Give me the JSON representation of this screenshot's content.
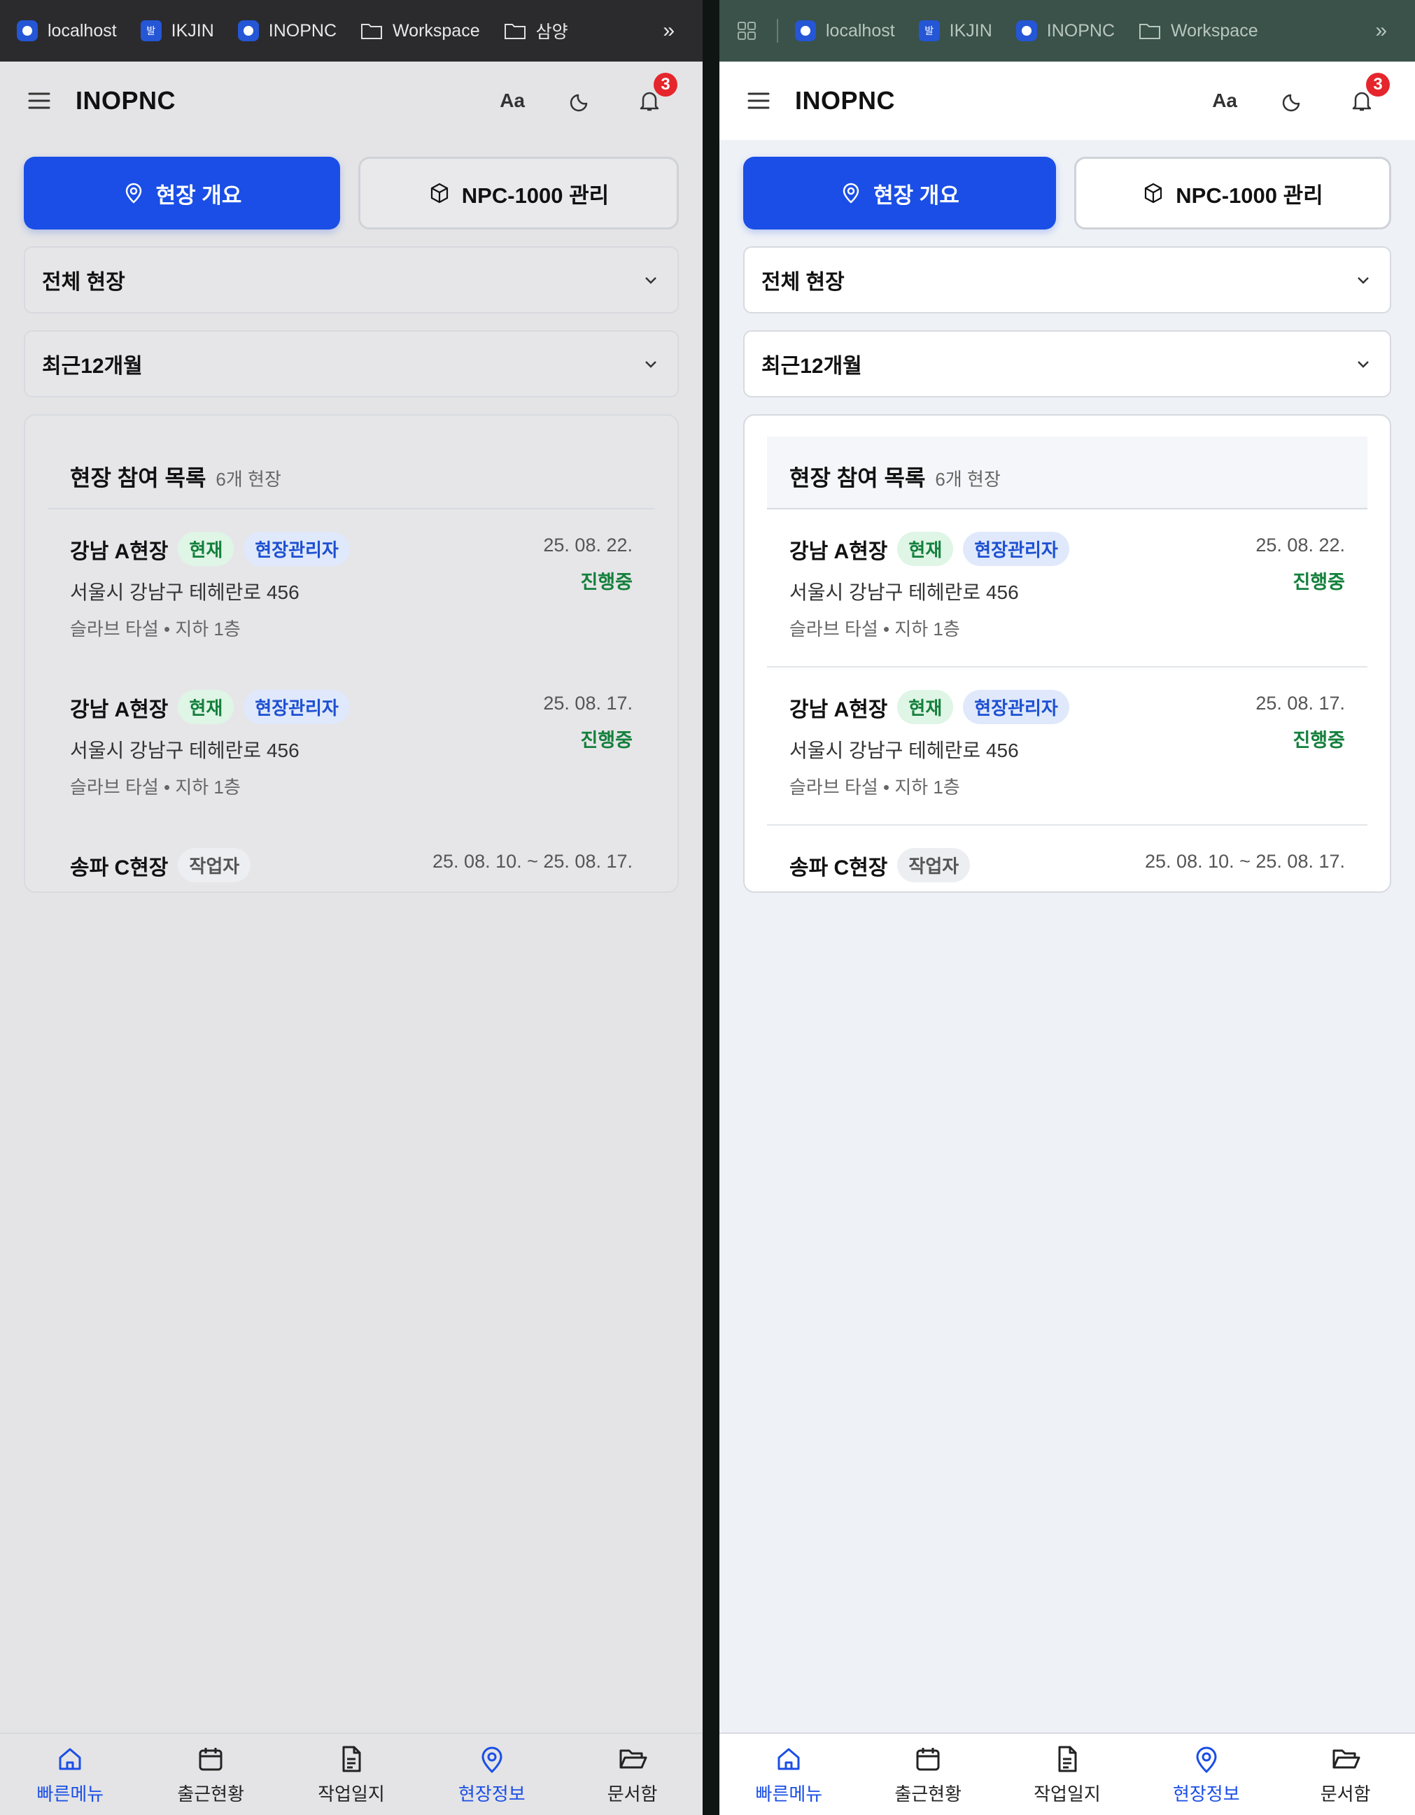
{
  "bookmarks_left": [
    {
      "label": "localhost",
      "icon": "app-favicon"
    },
    {
      "label": "IKJIN",
      "icon": "ikjin-favicon"
    },
    {
      "label": "INOPNC",
      "icon": "app-favicon"
    },
    {
      "label": "Workspace",
      "icon": "folder-icon"
    },
    {
      "label": "삼양",
      "icon": "folder-icon"
    }
  ],
  "bookmarks_right": [
    {
      "label": "localhost",
      "icon": "app-favicon"
    },
    {
      "label": "IKJIN",
      "icon": "ikjin-favicon"
    },
    {
      "label": "INOPNC",
      "icon": "app-favicon"
    },
    {
      "label": "Workspace",
      "icon": "folder-icon"
    }
  ],
  "bookmark_more": "»",
  "ikjin_glyph": "발",
  "header": {
    "brand": "INOPNC",
    "font_toggle": "Aa",
    "notification_count": "3"
  },
  "tabs": {
    "site_overview": "현장 개요",
    "npc_manage": "NPC-1000 관리"
  },
  "filters": {
    "site": "전체 현장",
    "period": "최근12개월"
  },
  "site_list": {
    "title": "현장 참여 목록",
    "count": "6개 현장",
    "items": [
      {
        "name": "강남 A현장",
        "chip1": "현재",
        "chip2": "현장관리자",
        "address": "서울시 강남구 테헤란로 456",
        "detail": "슬라브 타설 • 지하 1층",
        "date": "25. 08. 22.",
        "status": "진행중"
      },
      {
        "name": "강남 A현장",
        "chip1": "현재",
        "chip2": "현장관리자",
        "address": "서울시 강남구 테헤란로 456",
        "detail": "슬라브 타설 • 지하 1층",
        "date": "25. 08. 17.",
        "status": "진행중"
      },
      {
        "name": "송파 C현장",
        "chip1": "작업자",
        "chip2": "",
        "address": "",
        "detail": "",
        "date": "25. 08. 10. ~ 25. 08. 17.",
        "status": ""
      }
    ]
  },
  "bottom_nav": [
    {
      "label": "빠른메뉴",
      "icon": "home-icon",
      "active": true
    },
    {
      "label": "출근현황",
      "icon": "calendar-icon",
      "active": false
    },
    {
      "label": "작업일지",
      "icon": "document-icon",
      "active": false
    },
    {
      "label": "현장정보",
      "icon": "map-pin-icon",
      "active": true
    },
    {
      "label": "문서함",
      "icon": "folder-open-icon",
      "active": false
    }
  ],
  "colors": {
    "accent": "#1a4ee6",
    "status_green": "#14803c",
    "badge_red": "#e5262c"
  }
}
